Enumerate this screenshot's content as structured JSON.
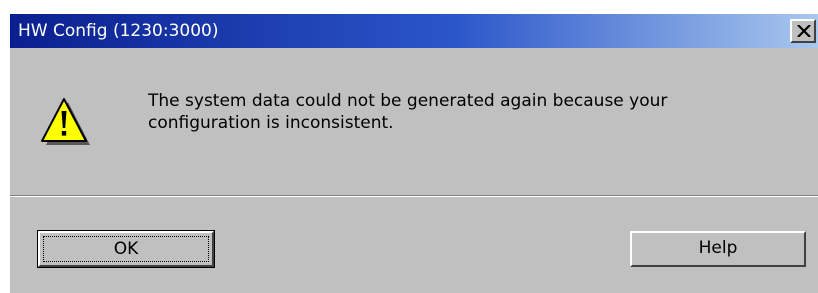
{
  "window": {
    "title": "HW Config  (1230:3000)",
    "close_label": "close"
  },
  "message": {
    "line1": "The system data could not be generated again because your",
    "line2": "configuration is inconsistent.",
    "icon": "warning-icon"
  },
  "buttons": {
    "ok_label": "OK",
    "help_label": "Help"
  },
  "colors": {
    "titlebar_start": "#0a1f8f",
    "titlebar_end": "#a9c8ee",
    "dialog_face": "#c0c0c0",
    "warning_fill": "#ffff00"
  }
}
